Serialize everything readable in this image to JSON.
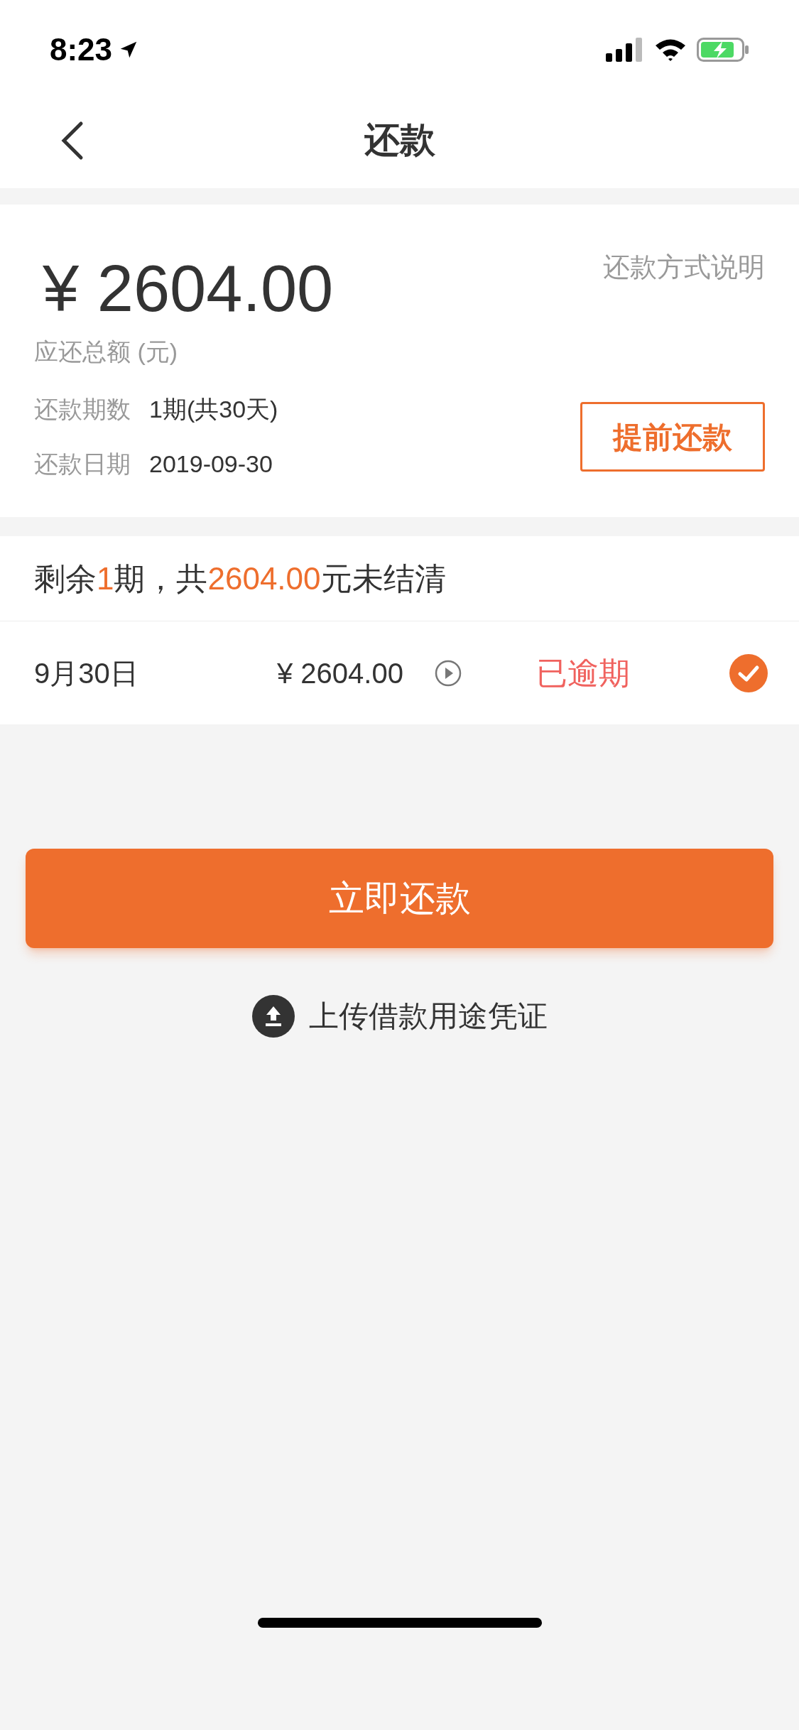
{
  "status_bar": {
    "time": "8:23"
  },
  "nav": {
    "title": "还款"
  },
  "summary": {
    "amount": "¥ 2604.00",
    "amount_label": "应还总额 (元)",
    "method_link": "还款方式说明",
    "details": [
      {
        "label": "还款期数",
        "value": "1期(共30天)"
      },
      {
        "label": "还款日期",
        "value": "2019-09-30"
      }
    ],
    "prepay_button": "提前还款"
  },
  "remaining": {
    "parts": [
      {
        "text": "剩余",
        "highlight": false
      },
      {
        "text": "1",
        "highlight": true
      },
      {
        "text": "期，共",
        "highlight": false
      },
      {
        "text": "2604.00",
        "highlight": true
      },
      {
        "text": "元未结清",
        "highlight": false
      }
    ]
  },
  "installments": [
    {
      "date": "9月30日",
      "amount": "¥ 2604.00",
      "status": "已逾期",
      "checked": true
    }
  ],
  "pay_button": "立即还款",
  "upload_link": "上传借款用途凭证"
}
